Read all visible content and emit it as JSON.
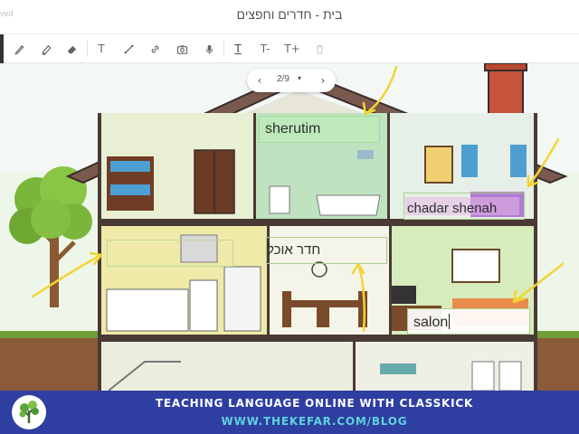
{
  "window": {
    "saved_status": "ved",
    "title": "בית - חדרים וחפצים"
  },
  "toolbar": {
    "tools": [
      {
        "name": "pen-icon"
      },
      {
        "name": "highlighter-icon"
      },
      {
        "name": "eraser-icon"
      },
      {
        "name": "text-tool-icon",
        "glyph": "T"
      },
      {
        "name": "line-icon"
      },
      {
        "name": "link-icon"
      },
      {
        "name": "camera-icon"
      },
      {
        "name": "microphone-icon"
      },
      {
        "name": "text-underline-icon",
        "glyph": "T"
      },
      {
        "name": "text-smaller-icon",
        "glyph": "T-"
      },
      {
        "name": "text-larger-icon",
        "glyph": "T+"
      },
      {
        "name": "trash-icon"
      }
    ]
  },
  "pager": {
    "prev_icon": "‹",
    "page_label": "2/9",
    "dropdown_icon": "▾",
    "next_icon": "›"
  },
  "labels": {
    "bathroom": "sherutim",
    "bedroom": "chadar shenah",
    "dining": "חדר אוכל",
    "living_room": "salon",
    "kitchen": ""
  },
  "banner": {
    "title": "TEACHING LANGUAGE ONLINE WITH CLASSKICK",
    "url": "WWW.THEKEFAR.COM/BLOG"
  },
  "colors": {
    "banner_bg": "#2f3ea1",
    "banner_url": "#5fd2dc",
    "annotation_pen": "#f2d533",
    "label_border": "#a9cf88",
    "highlight_pink": "#e7b8e6"
  }
}
